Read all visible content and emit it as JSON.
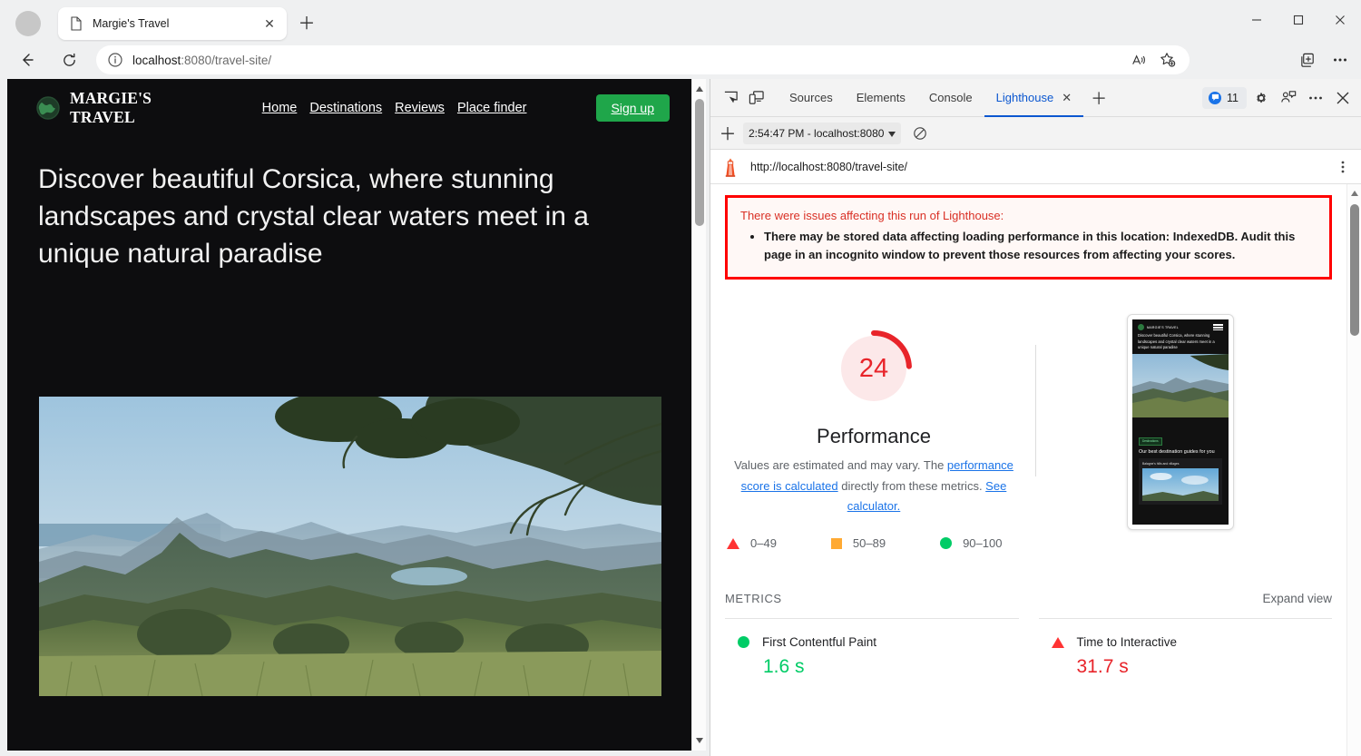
{
  "browser": {
    "tab": {
      "title": "Margie's Travel",
      "favicon_icon": "page-icon",
      "close_icon": "close-icon"
    },
    "new_tab_icon": "plus-icon",
    "window_controls": {
      "minimize": "minimize-icon",
      "maximize": "maximize-icon",
      "close": "close-icon"
    },
    "nav": {
      "back_icon": "back-arrow-icon",
      "reload_icon": "reload-icon"
    },
    "omnibox": {
      "info_icon": "info-circle-icon",
      "url_host": "localhost",
      "url_rest": ":8080/travel-site/",
      "read_aloud_icon": "read-aloud-icon",
      "favorite_icon": "add-favorite-star-icon"
    },
    "toolbar_right": {
      "collections_icon": "collections-icon",
      "more_icon": "more-ellipsis-icon"
    }
  },
  "site": {
    "brand": {
      "logo_icon": "globe-icon",
      "name": "MARGIE'S TRAVEL"
    },
    "nav_links": [
      "Home",
      "Destinations",
      "Reviews",
      "Place finder"
    ],
    "signup_label": "Sign up",
    "hero_heading": "Discover beautiful Corsica, where stunning landscapes and crystal clear waters meet in a unique natural paradise",
    "hero_image_alt": "corsica-mountain-landscape"
  },
  "devtools": {
    "inspect_icon": "inspect-element-icon",
    "device_toggle_icon": "device-toolbar-icon",
    "tabs": [
      {
        "label": "Sources",
        "active": false
      },
      {
        "label": "Elements",
        "active": false
      },
      {
        "label": "Console",
        "active": false
      },
      {
        "label": "Lighthouse",
        "active": true,
        "close_icon": "close-icon"
      }
    ],
    "add_tab_icon": "plus-icon",
    "issues": {
      "count": "11",
      "icon": "issue-bubble-icon"
    },
    "settings_icon": "gear-icon",
    "feedback_icon": "feedback-icon",
    "more_icon": "more-ellipsis-icon",
    "close_icon": "close-icon",
    "subbar": {
      "new_report_icon": "plus-icon",
      "run_selector": "2:54:47 PM - localhost:8080",
      "run_selector_caret": "chevron-down-icon",
      "clear_icon": "clear-all-icon"
    },
    "url_row": {
      "logo_icon": "lighthouse-icon",
      "url": "http://localhost:8080/travel-site/",
      "kebab_icon": "more-vertical-icon"
    }
  },
  "report": {
    "warning": {
      "title": "There were issues affecting this run of Lighthouse:",
      "items": [
        "There may be stored data affecting loading performance in this location: IndexedDB. Audit this page in an incognito window to prevent those resources from affecting your scores."
      ]
    },
    "score": {
      "value": "24",
      "category": "Performance",
      "description_pre": "Values are estimated and may vary. The ",
      "link_1": "performance score is calculated",
      "description_mid": " directly from these metrics. ",
      "link_2": "See calculator.",
      "color": "#e8242a",
      "track_color": "#fce8e9"
    },
    "legend": [
      {
        "icon": "triangle-icon",
        "label": "0–49",
        "color": "#ff3333"
      },
      {
        "icon": "square-icon",
        "label": "50–89",
        "color": "#ffaa33"
      },
      {
        "icon": "circle-icon",
        "label": "90–100",
        "color": "#00cc66"
      }
    ],
    "thumbnail": {
      "brand": "MARGIE'S TRAVEL",
      "menu_icon": "hamburger-icon",
      "hero": "Discover beautiful Corsica, where stunning landscapes and crystal clear waters meet in a unique natural paradise",
      "chip": "Destinations",
      "section_title": "Our best destination guides for you",
      "card_title": "Balagne's hills and villages"
    },
    "metrics": {
      "label": "METRICS",
      "expand_label": "Expand view",
      "items": [
        {
          "status_icon": "circle-icon",
          "status_color": "#00cc66",
          "name": "First Contentful Paint",
          "value": "1.6 s",
          "tone": "good"
        },
        {
          "status_icon": "triangle-icon",
          "status_color": "#ff3333",
          "name": "Time to Interactive",
          "value": "31.7 s",
          "tone": "bad"
        }
      ]
    }
  }
}
